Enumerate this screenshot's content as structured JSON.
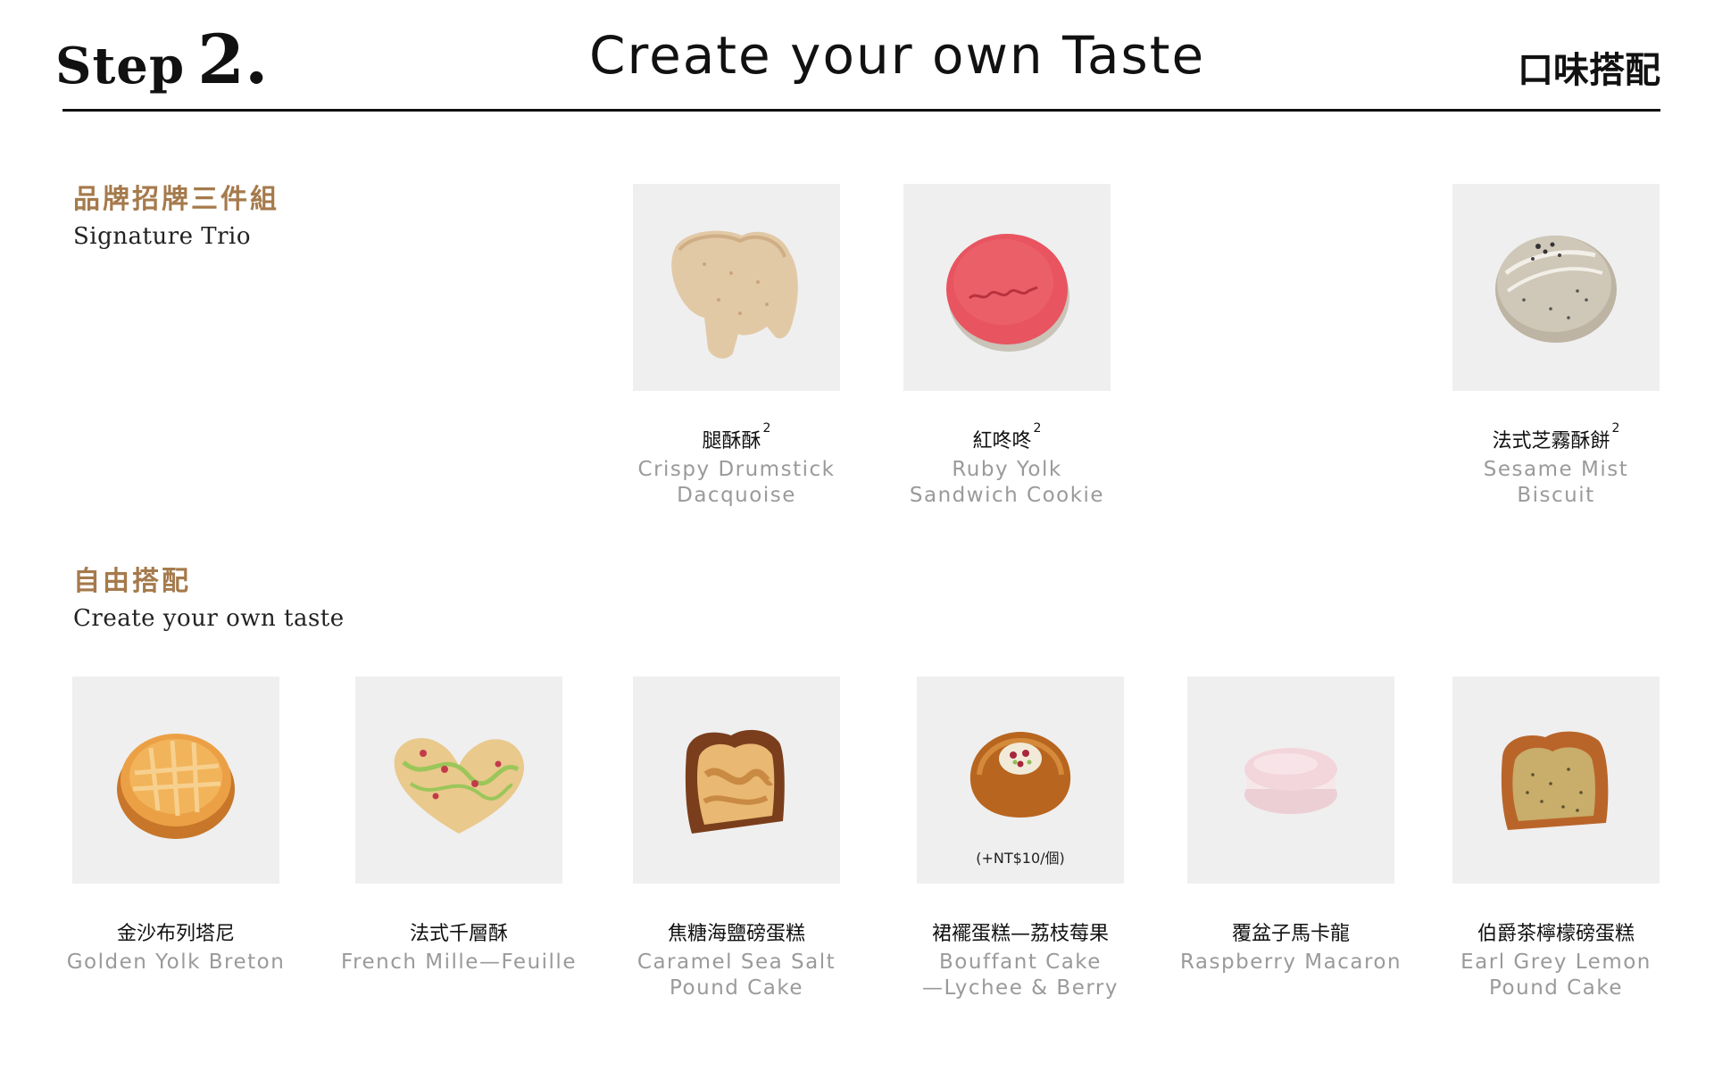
{
  "header": {
    "step_word": "Step",
    "step_number": "2.",
    "title": "Create your own Taste",
    "title_cn": "口味搭配"
  },
  "signature": {
    "label_cn": "品牌招牌三件組",
    "label_en": "Signature Trio",
    "items": [
      {
        "cn": "腿酥酥",
        "sup": "2",
        "en_line1": "Crispy Drumstick",
        "en_line2": "Dacquoise",
        "icon": "drumstick-dacquoise-icon"
      },
      {
        "cn": "紅咚咚",
        "sup": "2",
        "en_line1": "Ruby Yolk",
        "en_line2": "Sandwich Cookie",
        "icon": "ruby-yolk-cookie-icon"
      },
      {
        "cn": "法式芝霧酥餅",
        "sup": "2",
        "en_line1": "Sesame Mist",
        "en_line2": "Biscuit",
        "icon": "sesame-biscuit-icon"
      }
    ]
  },
  "custom": {
    "label_cn": "自由搭配",
    "label_en": "Create your own taste",
    "items": [
      {
        "cn": "金沙布列塔尼",
        "en_line1": "Golden Yolk Breton",
        "en_line2": "",
        "icon": "breton-tart-icon"
      },
      {
        "cn": "法式千層酥",
        "en_line1": "French Mille—Feuille",
        "en_line2": "",
        "icon": "palmier-icon"
      },
      {
        "cn": "焦糖海鹽磅蛋糕",
        "en_line1": "Caramel Sea Salt",
        "en_line2": "Pound Cake",
        "icon": "caramel-pound-cake-icon"
      },
      {
        "cn": "裙襬蛋糕—荔枝莓果",
        "en_line1": "Bouffant Cake",
        "en_line2": "—Lychee & Berry",
        "icon": "bouffant-cake-icon",
        "price_note": "(+NT$10/個)"
      },
      {
        "cn": "覆盆子馬卡龍",
        "en_line1": "Raspberry Macaron",
        "en_line2": "",
        "icon": "raspberry-macaron-icon"
      },
      {
        "cn": "伯爵茶檸檬磅蛋糕",
        "en_line1": "Earl Grey Lemon",
        "en_line2": "Pound Cake",
        "icon": "earl-grey-pound-cake-icon"
      }
    ]
  },
  "colors": {
    "accent": "#a57a4c",
    "card_bg": "#efefef",
    "subtitle_gray": "#9a9a9a"
  }
}
